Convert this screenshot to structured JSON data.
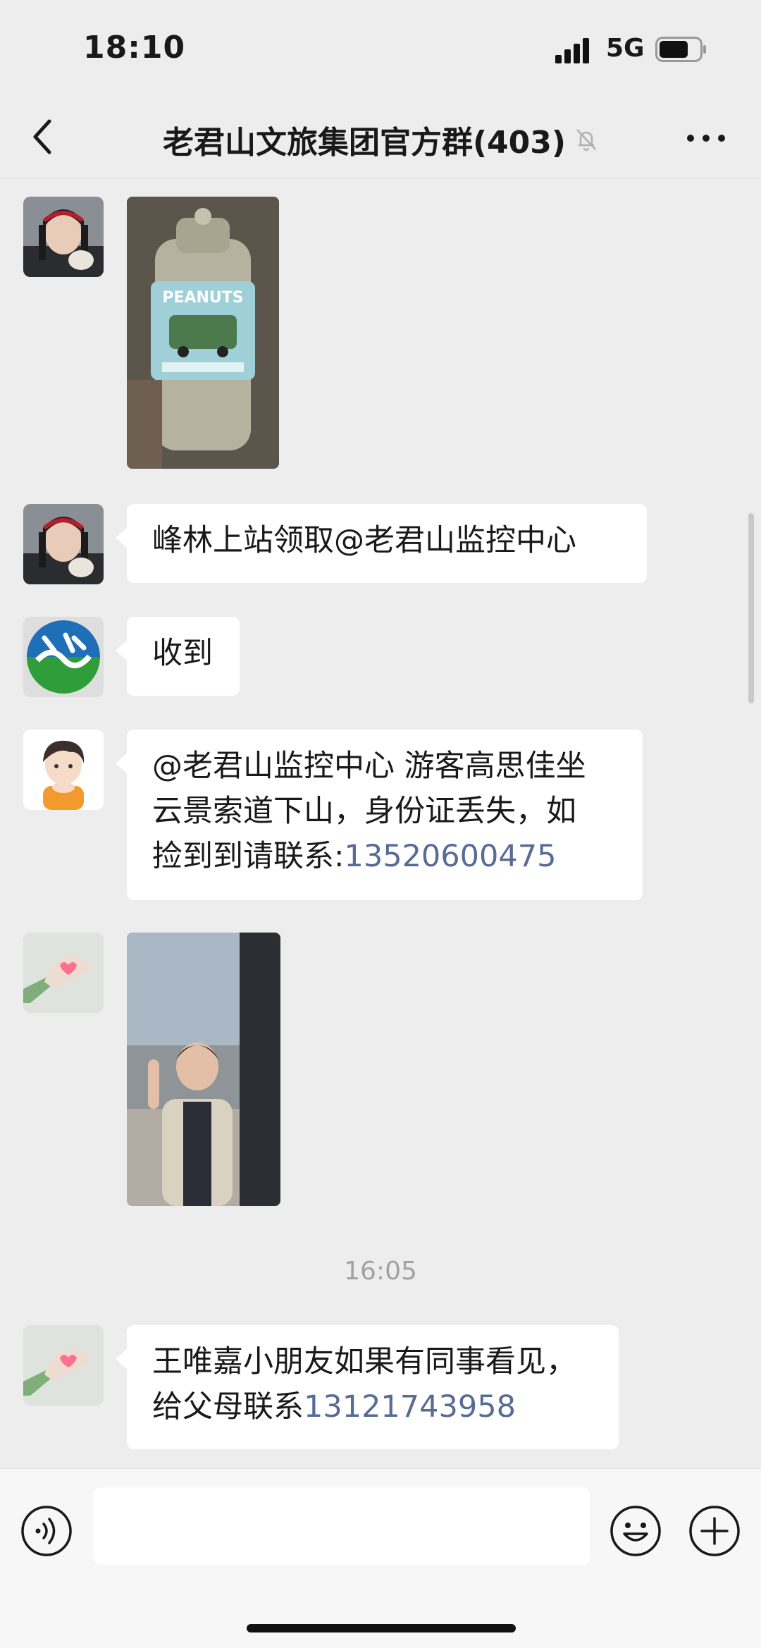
{
  "status_bar": {
    "time": "18:10",
    "network": "5G"
  },
  "nav": {
    "title": "老君山文旅集团官方群(403)"
  },
  "messages": [
    {
      "type": "image",
      "sender_avatar": "woman-red-headband-avatar",
      "image_desc": "water-bottle-photo"
    },
    {
      "type": "text",
      "sender_avatar": "woman-red-headband-avatar",
      "text": "峰林上站领取@老君山监控中心"
    },
    {
      "type": "text",
      "sender_avatar": "blue-green-logo-avatar",
      "text": "收到"
    },
    {
      "type": "text",
      "sender_avatar": "cartoon-boy-avatar",
      "line1": "@老君山监控中心 游客高思佳坐",
      "line2": "云景索道下山，身份证丢失，如",
      "line3_prefix": "捡到到请联系:",
      "phone": "13520600475"
    },
    {
      "type": "image",
      "sender_avatar": "hand-heart-avatar",
      "image_desc": "child-photo"
    },
    {
      "type": "time",
      "text": "16:05"
    },
    {
      "type": "text",
      "sender_avatar": "hand-heart-avatar",
      "line1": "王唯嘉小朋友如果有同事看见，",
      "line2_prefix": "给父母联系",
      "phone": "13121743958"
    }
  ],
  "input": {
    "placeholder": ""
  },
  "colors": {
    "background": "#ededed",
    "link": "#576b95",
    "bubble": "#ffffff"
  }
}
